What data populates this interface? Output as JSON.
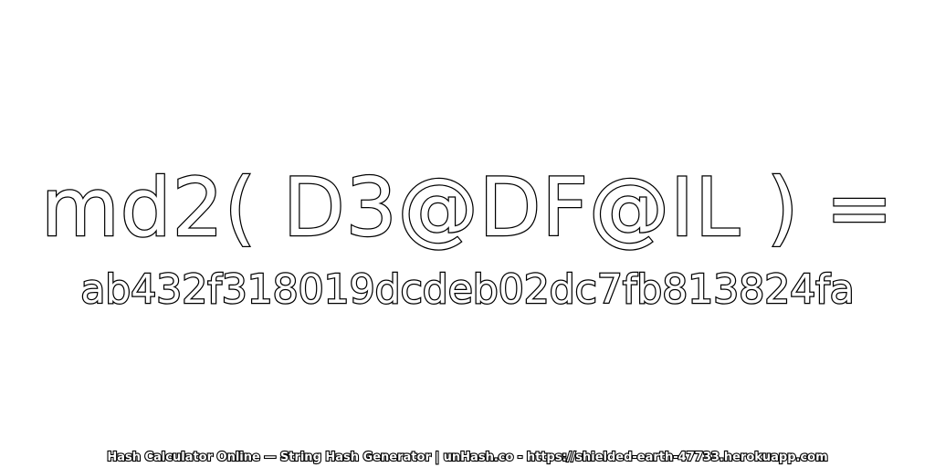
{
  "expression": "md2( D3@DF@IL ) =",
  "hash_value": "ab432f318019dcdeb02dc7fb813824fa",
  "footer": {
    "text": "Hash Calculator Online — String Hash Generator | unHash.co - https://shielded-earth-47733.herokuapp.com"
  },
  "colors": {
    "background": "#ffffff",
    "text_fill": "#ffffff",
    "text_stroke": "#000000"
  }
}
